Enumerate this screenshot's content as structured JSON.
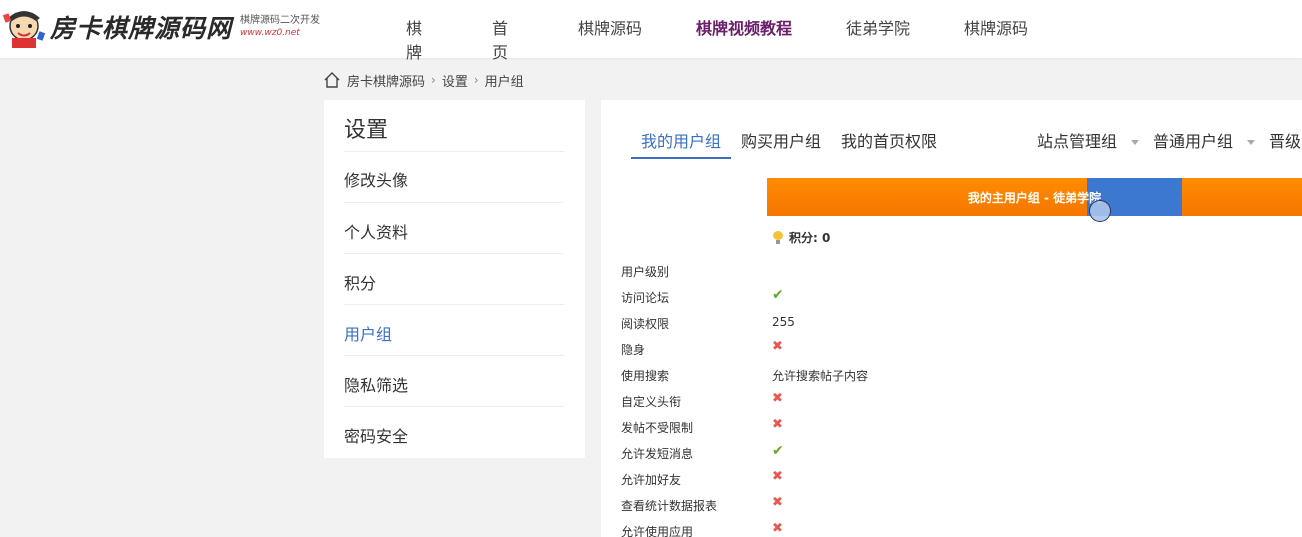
{
  "header": {
    "logo_text": "房卡棋牌源码网",
    "logo_subtitle": "棋牌源码二次开发",
    "logo_url": "www.wz0.net",
    "nav": [
      {
        "label": "棋牌",
        "active": false
      },
      {
        "label": "首页",
        "active": false
      },
      {
        "label": "棋牌源码",
        "active": false
      },
      {
        "label": "棋牌视频教程",
        "active": true
      },
      {
        "label": "徒弟学院",
        "active": false
      },
      {
        "label": "棋牌源码",
        "active": false
      }
    ]
  },
  "breadcrumb": {
    "items": [
      "房卡棋牌源码",
      "设置",
      "用户组"
    ],
    "separator": "›"
  },
  "sidebar": {
    "title": "设置",
    "items": [
      {
        "label": "修改头像",
        "active": false
      },
      {
        "label": "个人资料",
        "active": false
      },
      {
        "label": "积分",
        "active": false
      },
      {
        "label": "用户组",
        "active": true
      },
      {
        "label": "隐私筛选",
        "active": false
      },
      {
        "label": "密码安全",
        "active": false
      }
    ]
  },
  "main": {
    "tabs": [
      {
        "label": "我的用户组",
        "active": true
      },
      {
        "label": "购买用户组",
        "active": false
      },
      {
        "label": "我的首页权限",
        "active": false
      }
    ],
    "group_tabs": [
      "站点管理组",
      "普通用户组",
      "晋级"
    ],
    "banner": "我的主用户组 - 徒弟学院",
    "credits": "积分: 0",
    "permissions": [
      {
        "label": "用户级别",
        "type": "text",
        "value": ""
      },
      {
        "label": "访问论坛",
        "type": "yes",
        "value": "✔"
      },
      {
        "label": "阅读权限",
        "type": "text",
        "value": "255"
      },
      {
        "label": "隐身",
        "type": "no",
        "value": "✖"
      },
      {
        "label": "使用搜索",
        "type": "text",
        "value": "允许搜索帖子内容"
      },
      {
        "label": "自定义头衔",
        "type": "no",
        "value": "✖"
      },
      {
        "label": "发帖不受限制",
        "type": "no",
        "value": "✖"
      },
      {
        "label": "允许发短消息",
        "type": "yes",
        "value": "✔"
      },
      {
        "label": "允许加好友",
        "type": "no",
        "value": "✖"
      },
      {
        "label": "查看统计数据报表",
        "type": "no",
        "value": "✖"
      },
      {
        "label": "允许使用应用",
        "type": "no",
        "value": "✖"
      }
    ]
  },
  "colors": {
    "accent": "#3a6fc4",
    "nav_active": "#6b1f6b",
    "banner": "#ff8c00",
    "check": "#6aa829",
    "cross": "#e8584e"
  }
}
